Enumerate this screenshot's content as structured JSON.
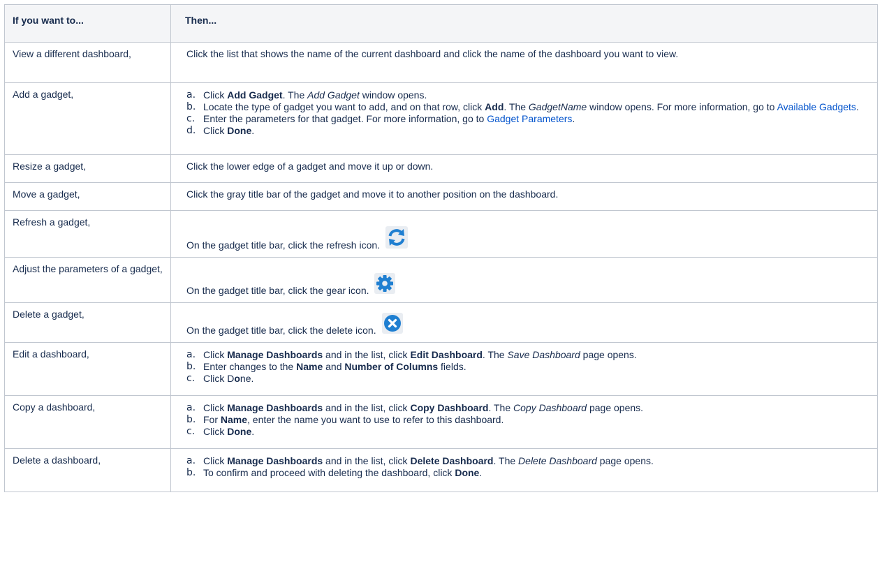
{
  "header": {
    "col1": "If you want to...",
    "col2": "Then..."
  },
  "rows": [
    {
      "when": "View a different dashboard,",
      "then": "Click the list that shows the name of the current dashboard and click the name of the dashboard you want to view."
    },
    {
      "when": "Add a gadget,",
      "steps": [
        {
          "marker": "a.",
          "t1": "Click ",
          "b1": "Add Gadget",
          "t2": ". The ",
          "i1": "Add Gadget",
          "t3": " window opens."
        },
        {
          "marker": "b.",
          "t1": "Locate the type of gadget you want to add, and on that row, click ",
          "b1": "Add",
          "t2": ". The ",
          "i1": "GadgetName",
          "t3": " window opens. For more information, go to ",
          "link": "Available Gadgets",
          "t4": "."
        },
        {
          "marker": "c.",
          "t1": "Enter the parameters for that gadget. For more information, go to ",
          "link": "Gadget Parameters",
          "t2": "."
        },
        {
          "marker": "d.",
          "t1": "Click ",
          "b1": "Done",
          "t2": "."
        }
      ]
    },
    {
      "when": "Resize a gadget,",
      "then": "Click the lower edge of a gadget and move it up or down."
    },
    {
      "when": "Move a gadget,",
      "then": "Click the gray title bar of the gadget and move it to another position on the dashboard."
    },
    {
      "when": "Refresh a gadget,",
      "then": "On the gadget title bar, click the refresh icon.",
      "icon": "refresh-icon"
    },
    {
      "when": "Adjust the parameters of a gadget,",
      "then": "On the gadget title bar, click the gear icon.",
      "icon": "gear-icon"
    },
    {
      "when": "Delete a gadget,",
      "then": "On the gadget title bar, click the delete icon.",
      "icon": "delete-icon"
    },
    {
      "when": "Edit a dashboard,",
      "steps": [
        {
          "marker": "a.",
          "t1": "Click ",
          "b1": "Manage Dashboards",
          "t2": " and in the list, click ",
          "b2": "Edit Dashboard",
          "t3": ". The ",
          "i1": "Save Dashboard",
          "t4": " page opens."
        },
        {
          "marker": "b.",
          "t1": "Enter changes to the ",
          "b1": "Name",
          "t2": " and ",
          "b2": "Number of Columns",
          "t3": " fields."
        },
        {
          "marker": "c.",
          "t1": "Click D",
          "b1": "o",
          "t2": "ne."
        }
      ]
    },
    {
      "when": "Copy a dashboard,",
      "steps": [
        {
          "marker": "a.",
          "t1": "Click ",
          "b1": "Manage Dashboards",
          "t2": " and in the list, click ",
          "b2": "Copy Dashboard",
          "t3": ". The ",
          "i1": "Copy Dashboard",
          "t4": " page opens."
        },
        {
          "marker": "b.",
          "t1": "For ",
          "b1": "Name",
          "t2": ", enter the name you want to use to refer to this dashboard."
        },
        {
          "marker": "c.",
          "t1": "Click ",
          "b1": "Done",
          "t2": "."
        }
      ]
    },
    {
      "when": "Delete a dashboard,",
      "steps": [
        {
          "marker": "a.",
          "t1": "Click ",
          "b1": "Manage Dashboards",
          "t2": " and in the list, click ",
          "b2": "Delete Dashboard",
          "t3": ". The ",
          "i1": "Delete Dashboard",
          "t4": " page opens."
        },
        {
          "marker": "b.",
          "t1": "To confirm and proceed with deleting the dashboard, click ",
          "b1": "Done",
          "t2": "."
        }
      ]
    }
  ],
  "colors": {
    "link": "#0052cc",
    "header_bg": "#f4f5f7",
    "border": "#c1c7d0",
    "icon_blue": "#1f7fd1"
  }
}
